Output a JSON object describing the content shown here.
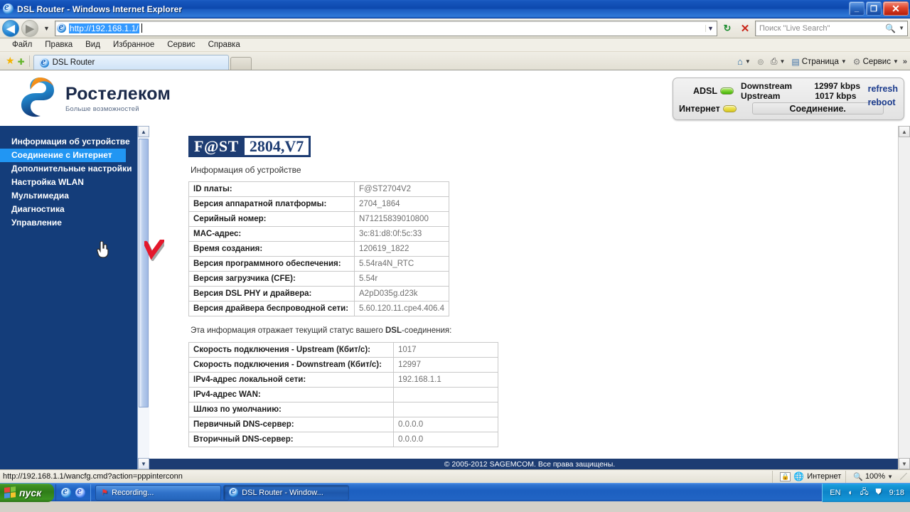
{
  "window": {
    "title": "DSL Router - Windows Internet Explorer",
    "minimize": "_",
    "maximize": "❐",
    "close": "✕"
  },
  "address_bar": {
    "url": "http://192.168.1.1/",
    "back_icon": "◀",
    "forward_icon": "▶",
    "dropdown_icon": "▼",
    "refresh_icon": "↻",
    "stop_icon": "✕",
    "search_placeholder": "Поиск \"Live Search\"",
    "search_icon": "🔍",
    "search_arrow": "▼"
  },
  "menu": {
    "items": [
      "Файл",
      "Правка",
      "Вид",
      "Избранное",
      "Сервис",
      "Справка"
    ]
  },
  "tabs": {
    "favorites_icon": "★",
    "add_favorite_icon": "✚",
    "open_tab": "DSL Router",
    "new_tab_label": "",
    "right_tools": [
      {
        "name": "home",
        "icon": "⌂",
        "label": ""
      },
      {
        "name": "feeds",
        "icon": "⊚",
        "label": ""
      },
      {
        "name": "print",
        "icon": "⎙",
        "label": ""
      },
      {
        "name": "page",
        "icon": "▤",
        "label": "Страница"
      },
      {
        "name": "tools",
        "icon": "⚙",
        "label": "Сервис"
      }
    ],
    "overflow_icon": "»"
  },
  "brand": {
    "name": "Ростелеком",
    "tagline": "Больше возможностей"
  },
  "status_panel": {
    "adsl_label": "ADSL",
    "downstream_label": "Downstream",
    "downstream_value": "12997 kbps",
    "upstream_label": "Upstream",
    "upstream_value": "1017 kbps",
    "internet_label": "Интернет",
    "connection_label": "Соединение.",
    "refresh_label": "refresh",
    "reboot_label": "reboot"
  },
  "sidebar": {
    "items": [
      {
        "label": "Информация об устройстве",
        "active": false
      },
      {
        "label": "Соединение с Интернет",
        "active": true
      },
      {
        "label": "Дополнительные настройки",
        "active": false
      },
      {
        "label": "Настройка WLAN",
        "active": false
      },
      {
        "label": "Мультимедиа",
        "active": false
      },
      {
        "label": "Диагностика",
        "active": false
      },
      {
        "label": "Управление",
        "active": false
      }
    ]
  },
  "content": {
    "logo_left": "F@ST",
    "logo_right": "2804,V7",
    "section_title": "Информация об устройстве",
    "device_table": [
      {
        "key": "ID платы:",
        "value": "F@ST2704V2"
      },
      {
        "key": "Версия аппаратной платформы:",
        "value": "2704_1864"
      },
      {
        "key": "Серийный номер:",
        "value": "N71215839010800"
      },
      {
        "key": "MAC-адрес:",
        "value": "3c:81:d8:0f:5c:33"
      },
      {
        "key": "Время создания:",
        "value": "120619_1822"
      },
      {
        "key": "Версия программного обеспечения:",
        "value": "5.54ra4N_RTC"
      },
      {
        "key": "Версия загрузчика (CFE):",
        "value": "5.54r"
      },
      {
        "key": "Версия DSL PHY и драйвера:",
        "value": "A2pD035g.d23k"
      },
      {
        "key": "Версия драйвера беспроводной сети:",
        "value": "5.60.120.11.cpe4.406.4"
      }
    ],
    "dsl_note_prefix": "Эта информация отражает текущий статус вашего ",
    "dsl_note_bold": "DSL",
    "dsl_note_suffix": "-соединения:",
    "status_table": [
      {
        "key": "Скорость подключения - Upstream (Кбит/с):",
        "value": "1017"
      },
      {
        "key": "Скорость подключения - Downstream (Кбит/с):",
        "value": "12997"
      },
      {
        "key": "IPv4-адрес локальной сети:",
        "value": "192.168.1.1"
      },
      {
        "key": "IPv4-адрес WAN:",
        "value": ""
      },
      {
        "key": "Шлюз по умолчанию:",
        "value": ""
      },
      {
        "key": "Первичный DNS-сервер:",
        "value": "0.0.0.0"
      },
      {
        "key": "Вторичный DNS-сервер:",
        "value": "0.0.0.0"
      }
    ],
    "footer": "© 2005-2012 SAGEMCOM. Все права защищены."
  },
  "status_bar": {
    "link_url": "http://192.168.1.1/wancfg.cmd?action=pppinterconn",
    "zone_label": "Интернет",
    "zone_icon": "globe-icon",
    "zoom_level": "100%",
    "zoom_arrow": "▼"
  },
  "taskbar": {
    "start_label": "пуск",
    "quicklaunch": [
      "ie-icon",
      "desktop-icon"
    ],
    "tasks": [
      {
        "label": "Recording...",
        "icon": "record-icon",
        "active": false
      },
      {
        "label": "DSL Router - Window...",
        "icon": "ie-icon",
        "active": true
      }
    ],
    "tray": {
      "language": "EN",
      "icons": [
        "volume-icon",
        "network-icon",
        "security-icon"
      ],
      "clock": "9:18"
    }
  },
  "annotations": {
    "red_check_color": "#e4172b",
    "cursor": "hand-pointer"
  },
  "colors": {
    "brand_blue": "#143d7a",
    "accent_blue": "#2196f3",
    "header_dark": "#1d3c72"
  }
}
